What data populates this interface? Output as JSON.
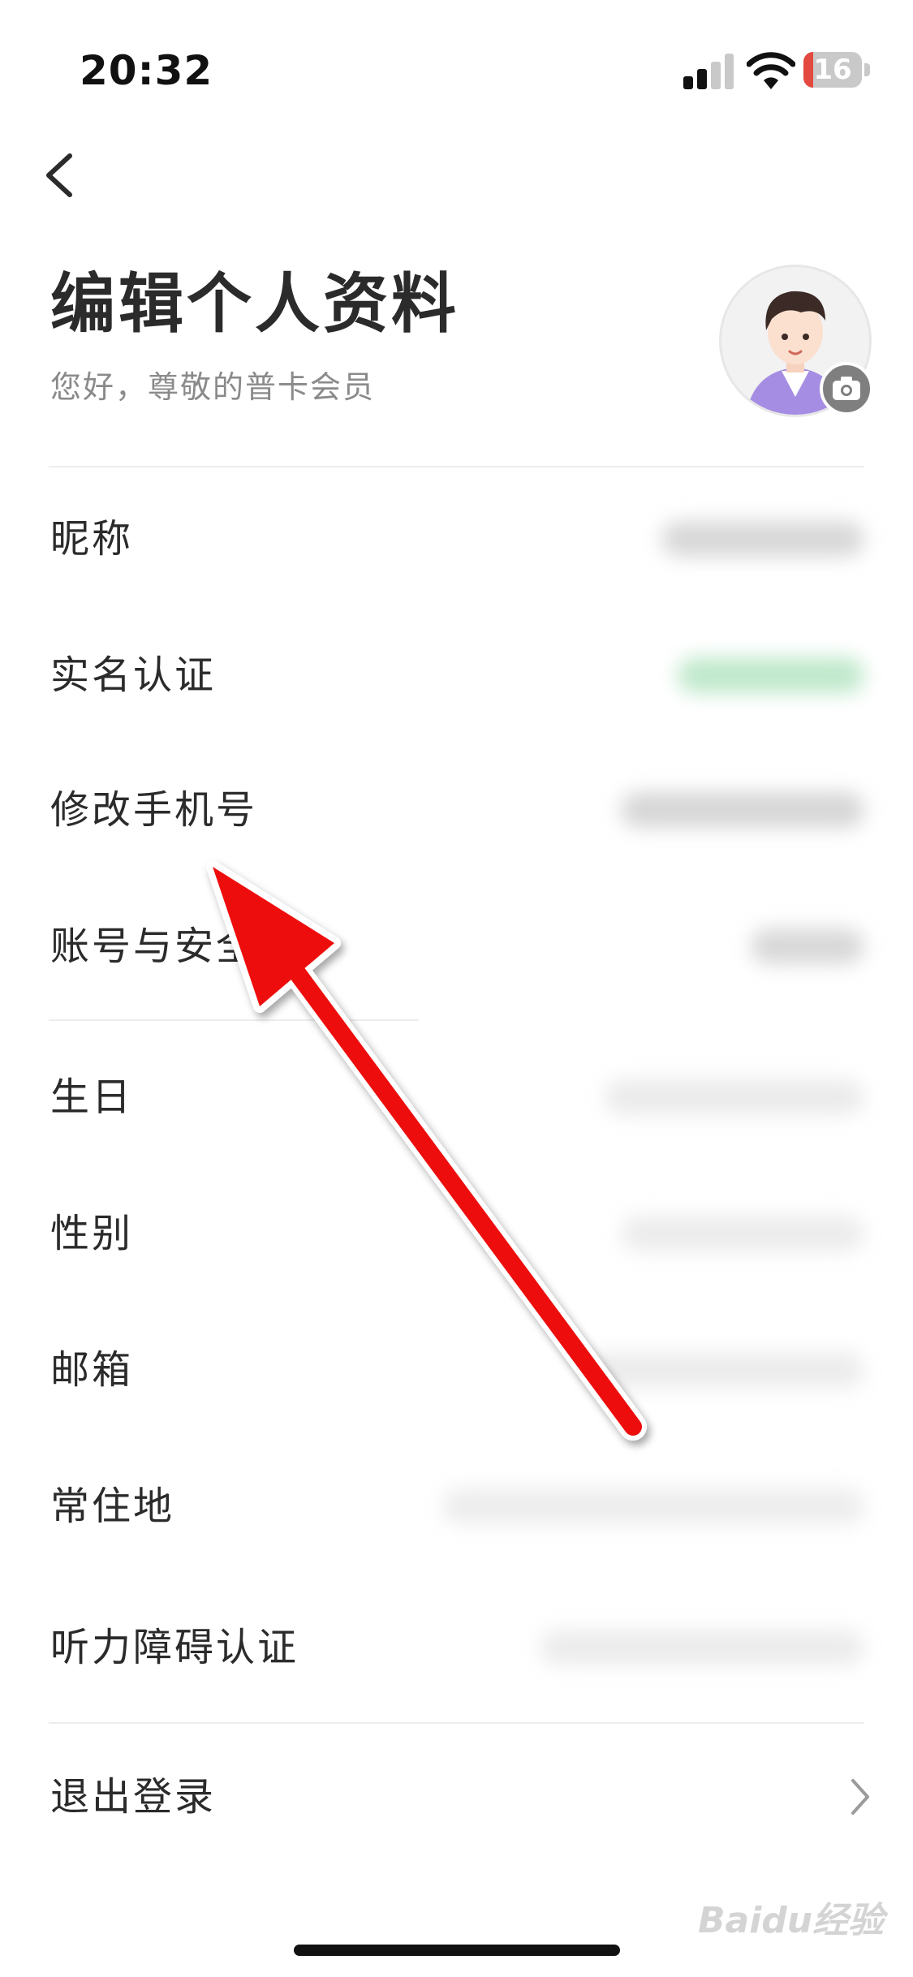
{
  "status_bar": {
    "time": "20:32",
    "battery_level": "16"
  },
  "header": {
    "title": "编辑个人资料",
    "subtitle": "您好，尊敬的普卡会员"
  },
  "rows": [
    {
      "label": "昵称"
    },
    {
      "label": "实名认证"
    },
    {
      "label": "修改手机号"
    },
    {
      "label": "账号与安全"
    },
    {
      "label": "生日"
    },
    {
      "label": "性别"
    },
    {
      "label": "邮箱"
    },
    {
      "label": "常住地"
    },
    {
      "label": "听力障碍认证"
    },
    {
      "label": "退出登录"
    }
  ],
  "watermark": "Baidu经验",
  "colors": {
    "annotation_arrow": "#ee1111",
    "battery_low": "#e2493f",
    "verified_green": "#6fd08c"
  }
}
